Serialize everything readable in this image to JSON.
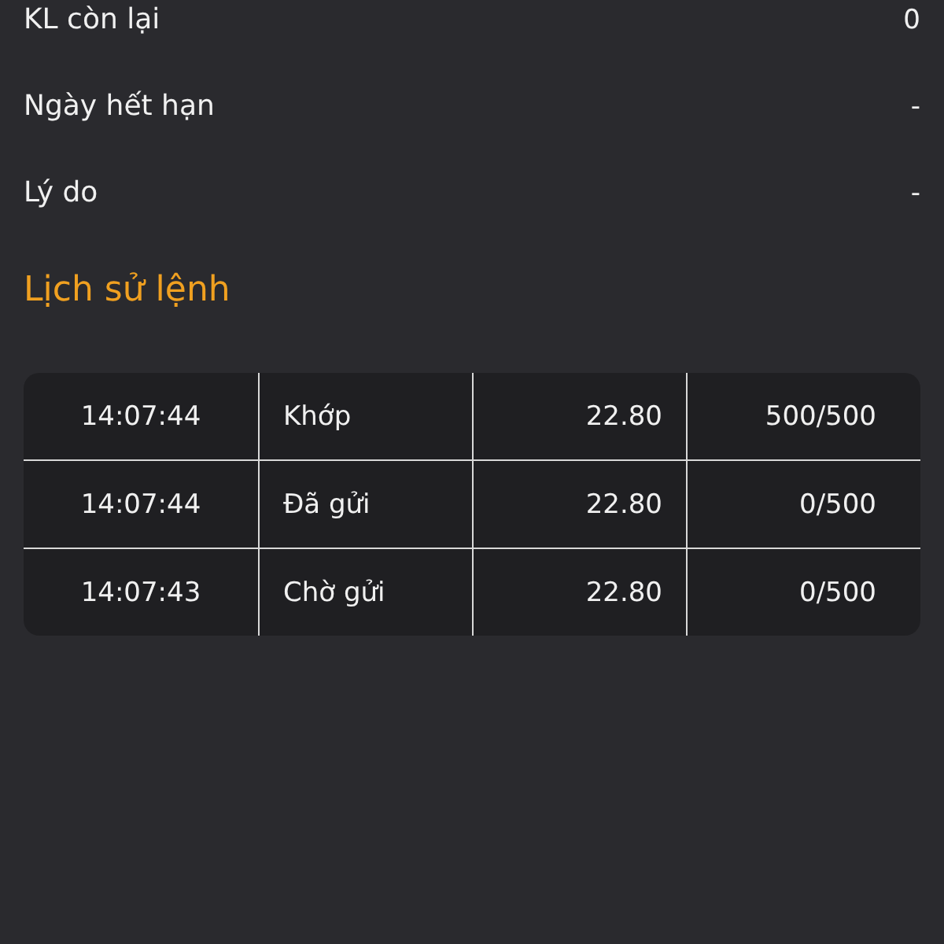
{
  "details": [
    {
      "label": "KL còn lại",
      "value": "0"
    },
    {
      "label": "Ngày hết hạn",
      "value": "-"
    },
    {
      "label": "Lý do",
      "value": "-"
    }
  ],
  "history": {
    "title": "Lịch sử lệnh",
    "rows": [
      {
        "time": "14:07:44",
        "status": "Khớp",
        "price": "22.80",
        "volume": "500/500"
      },
      {
        "time": "14:07:44",
        "status": "Đã gửi",
        "price": "22.80",
        "volume": "0/500"
      },
      {
        "time": "14:07:43",
        "status": "Chờ gửi",
        "price": "22.80",
        "volume": "0/500"
      }
    ]
  }
}
